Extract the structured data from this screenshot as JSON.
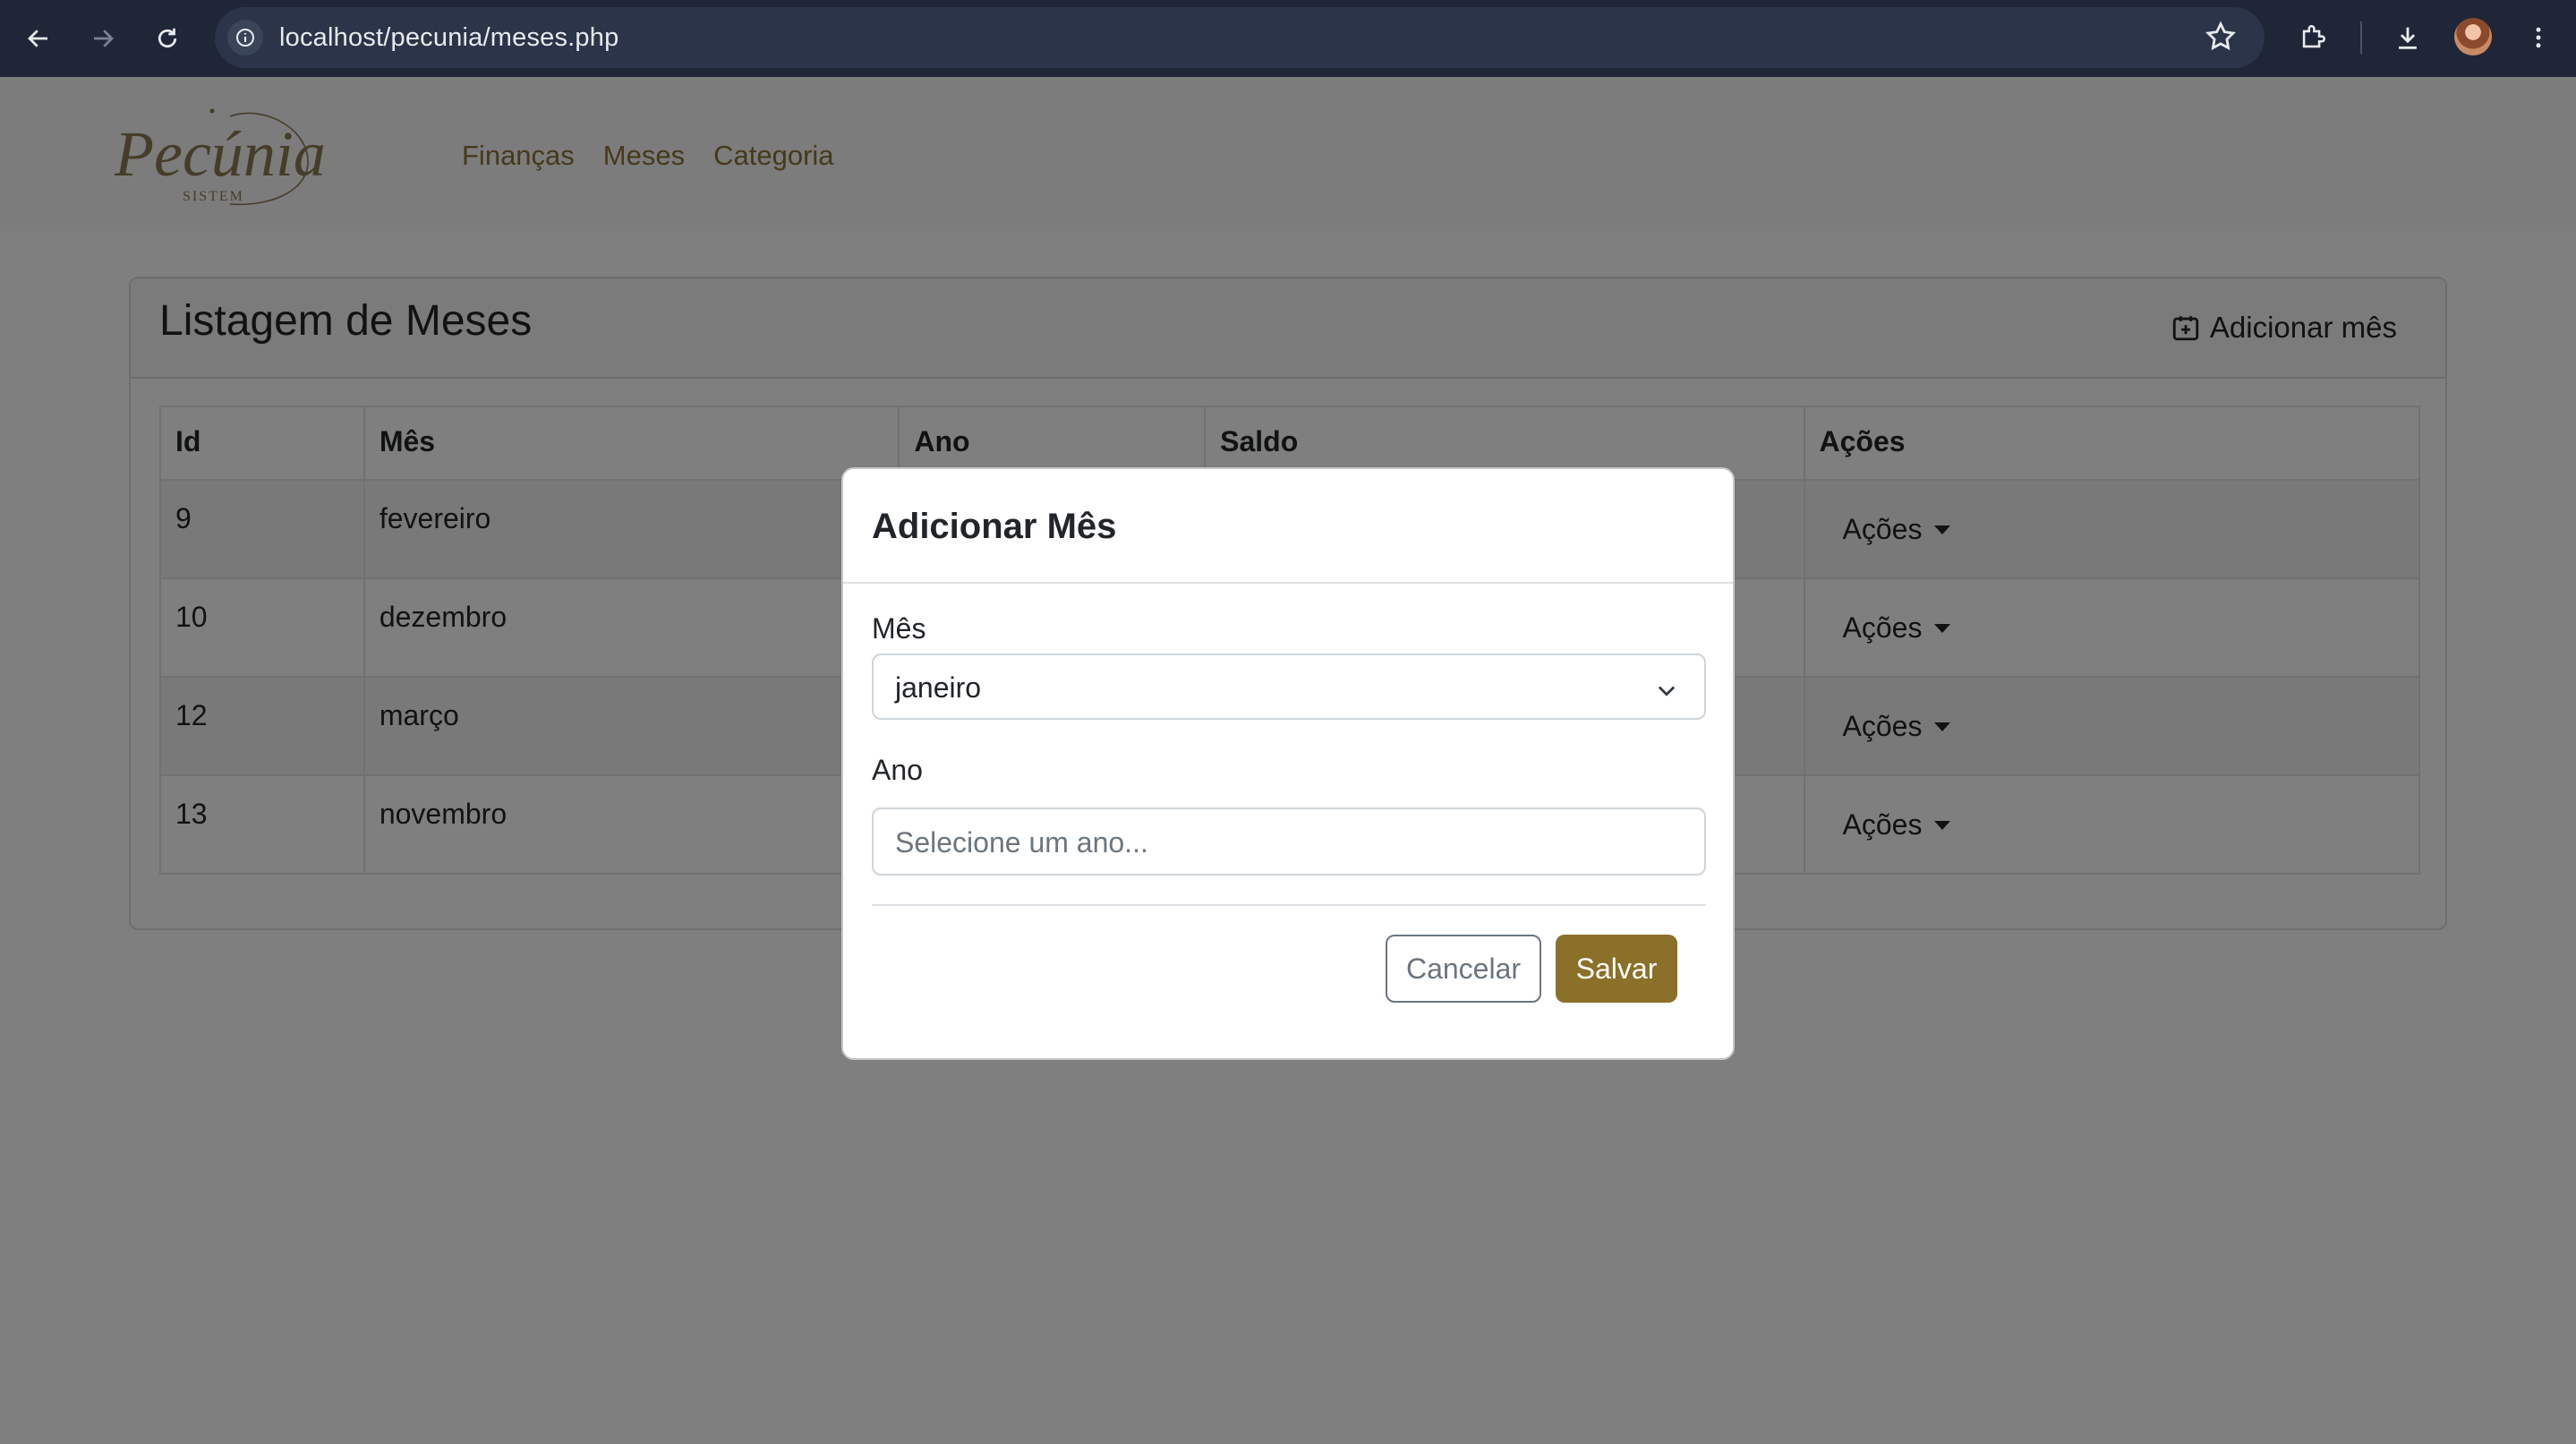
{
  "browser": {
    "url": "localhost/pecunia/meses.php"
  },
  "navbar": {
    "logo_text": "Pecúnia",
    "logo_subtext": "SISTEM",
    "links": [
      "Finanças",
      "Meses",
      "Categoria"
    ]
  },
  "card": {
    "title": "Listagem de Meses",
    "add_button_label": "Adicionar mês"
  },
  "table": {
    "headers": [
      "Id",
      "Mês",
      "Ano",
      "Saldo",
      "Ações"
    ],
    "rows": [
      {
        "id": "9",
        "mes": "fevereiro",
        "acoes": "Ações"
      },
      {
        "id": "10",
        "mes": "dezembro",
        "acoes": "Ações"
      },
      {
        "id": "12",
        "mes": "março",
        "acoes": "Ações"
      },
      {
        "id": "13",
        "mes": "novembro",
        "acoes": "Ações"
      }
    ]
  },
  "modal": {
    "title": "Adicionar Mês",
    "mes_label": "Mês",
    "mes_value": "janeiro",
    "ano_label": "Ano",
    "ano_placeholder": "Selecione um ano...",
    "cancel_label": "Cancelar",
    "save_label": "Salvar"
  },
  "colors": {
    "brand": "#8b7029",
    "chrome_bg": "#1f2637",
    "backdrop": "rgba(0,0,0,0.5)"
  }
}
